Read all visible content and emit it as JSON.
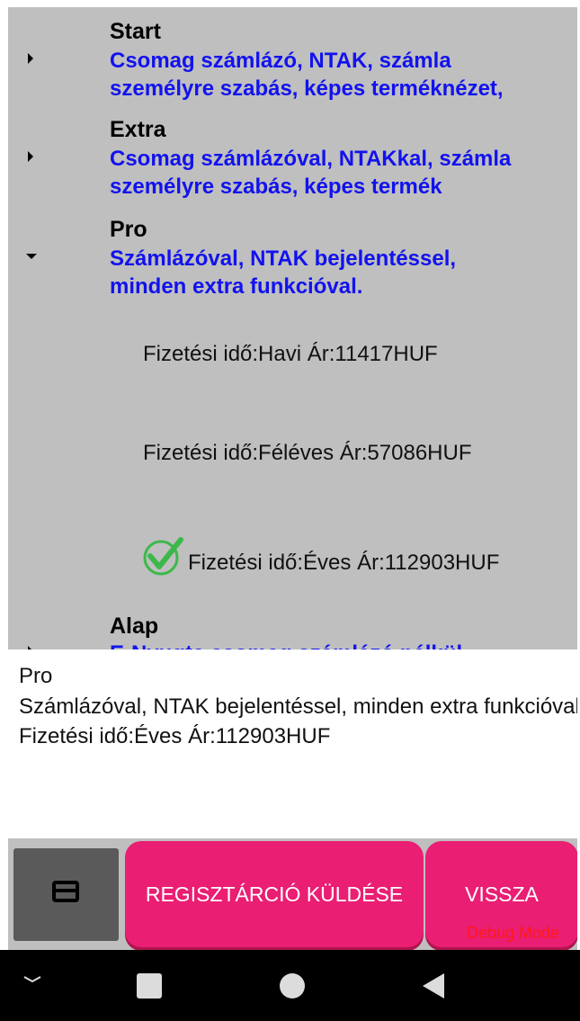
{
  "packages": [
    {
      "name": "Start",
      "description": "Csomag számlázó, NTAK, számla\nszemélyre szabás, képes terméknézet,",
      "expanded": false
    },
    {
      "name": "Extra",
      "description": "Csomag számlázóval, NTAKkal, számla\nszemélyre szabás, képes termék",
      "expanded": false
    },
    {
      "name": "Pro",
      "description": "Számlázóval, NTAK bejelentéssel,\nminden extra funkcióval.",
      "expanded": true,
      "options": [
        {
          "label": "Fizetési idő:Havi Ár:11417HUF",
          "selected": false
        },
        {
          "label": "Fizetési idő:Féléves Ár:57086HUF",
          "selected": false
        },
        {
          "label": "Fizetési idő:Éves Ár:112903HUF",
          "selected": true
        }
      ]
    },
    {
      "name": "Alap",
      "description": "E-Nyugta csomag számlázó nélkül",
      "expanded": false
    }
  ],
  "summary": {
    "line1": "Pro",
    "line2": "Számlázóval, NTAK bejelentéssel, minden extra funkcióval.",
    "line3": "Fizetési idő:Éves Ár:112903HUF"
  },
  "buttons": {
    "card_icon": "credit-card-icon",
    "register": "REGISZTÁRCIÓ KÜLDÉSE",
    "back": "VISSZA"
  },
  "debug_label": "Debug Mode",
  "nav_icons": [
    "chevron-down-icon",
    "recent-apps-icon",
    "home-icon",
    "back-icon"
  ],
  "colors": {
    "accent": "#ea1e73",
    "link_blue": "#1212ee",
    "check_green": "#3cb84a",
    "debug_red": "#ff1a1a"
  }
}
